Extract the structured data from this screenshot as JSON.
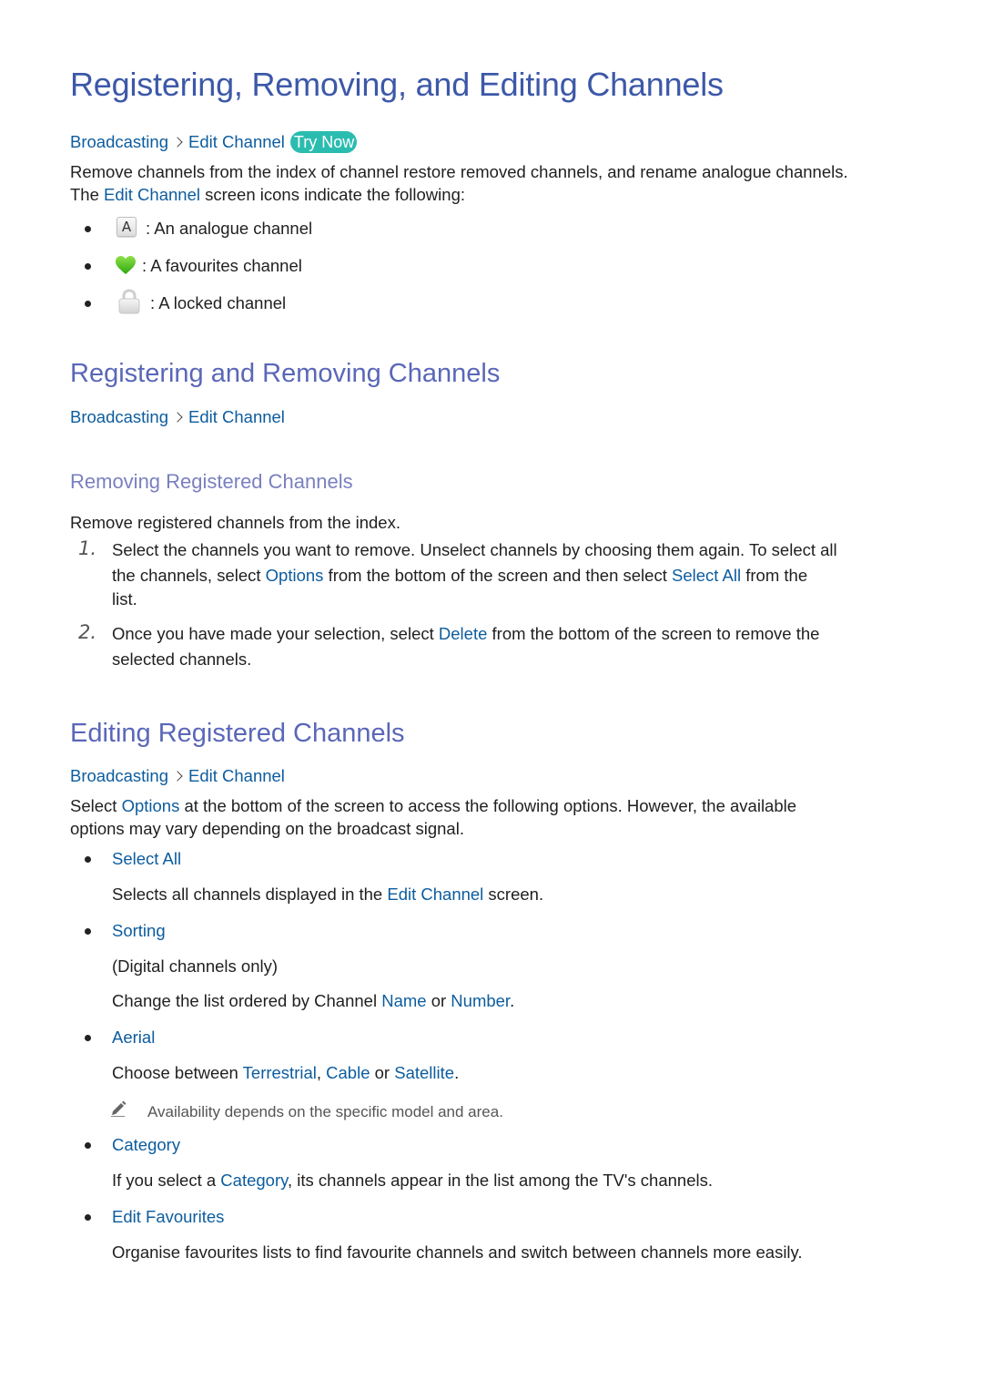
{
  "title": "Registering, Removing, and Editing Channels",
  "intro": {
    "breadcrumb": {
      "items": [
        "Broadcasting",
        "Edit Channel"
      ],
      "try_now": "Try Now"
    },
    "description_line1": "Remove channels from the index of channel restore removed channels, and rename analogue channels.",
    "description_line2_prefix": "The ",
    "description_line2_link": "Edit Channel",
    "description_line2_suffix": " screen icons indicate the following:",
    "icons": [
      {
        "icon": "analogue-icon",
        "glyph": "A",
        "label": ": An analogue channel"
      },
      {
        "icon": "heart-icon",
        "label": ": A favourites channel"
      },
      {
        "icon": "lock-icon",
        "label": ": A locked channel"
      }
    ]
  },
  "section_register": {
    "heading": "Registering and Removing Channels",
    "breadcrumb": {
      "items": [
        "Broadcasting",
        "Edit Channel"
      ]
    },
    "subsection": {
      "heading": "Removing Registered Channels",
      "lead": "Remove registered channels from the index.",
      "steps": [
        {
          "number": "1.",
          "line1": "Select the channels you want to remove. Unselect channels by choosing them again. To select all",
          "line2_a": "the channels, select ",
          "line2_link1": "Options",
          "line2_b": " from the bottom of the screen and then select ",
          "line2_link2": "Select All",
          "line2_c": " from the",
          "line3": "list."
        },
        {
          "number": "2.",
          "line1_a": "Once you have made your selection, select ",
          "line1_link": "Delete",
          "line1_b": " from the bottom of the screen to remove the",
          "line2": "selected channels."
        }
      ]
    }
  },
  "section_edit": {
    "heading": "Editing Registered Channels",
    "breadcrumb": {
      "items": [
        "Broadcasting",
        "Edit Channel"
      ]
    },
    "intro_a": "Select ",
    "intro_link": "Options",
    "intro_b": " at the bottom of the screen to access the following options. However, the available",
    "intro_line2": "options may vary depending on the broadcast signal.",
    "options": [
      {
        "title": "Select All",
        "desc_a": "Selects all channels displayed in the ",
        "desc_link": "Edit Channel",
        "desc_b": " screen."
      },
      {
        "title": "Sorting",
        "desc1": "(Digital channels only)",
        "desc2_a": "Change the list ordered by Channel ",
        "desc2_link1": "Name",
        "desc2_b": " or ",
        "desc2_link2": "Number",
        "desc2_c": "."
      },
      {
        "title": "Aerial",
        "desc_a": "Choose between ",
        "desc_link1": "Terrestrial",
        "desc_b": ", ",
        "desc_link2": "Cable",
        "desc_c": " or ",
        "desc_link3": "Satellite",
        "desc_d": ".",
        "note": "Availability depends on the specific model and area."
      },
      {
        "title": "Category",
        "desc_a": "If you select a ",
        "desc_link": "Category",
        "desc_b": ", its channels appear in the list among the TV's channels."
      },
      {
        "title": "Edit Favourites",
        "desc": "Organise favourites lists to find favourite channels and switch between channels more easily."
      }
    ]
  },
  "colors": {
    "title": "#3c58a8",
    "heading2": "#5a67b8",
    "heading3": "#7a80c0",
    "link": "#0c5c9e",
    "try_now_bg": "#2bbcb0",
    "text": "#1f1f1f"
  }
}
